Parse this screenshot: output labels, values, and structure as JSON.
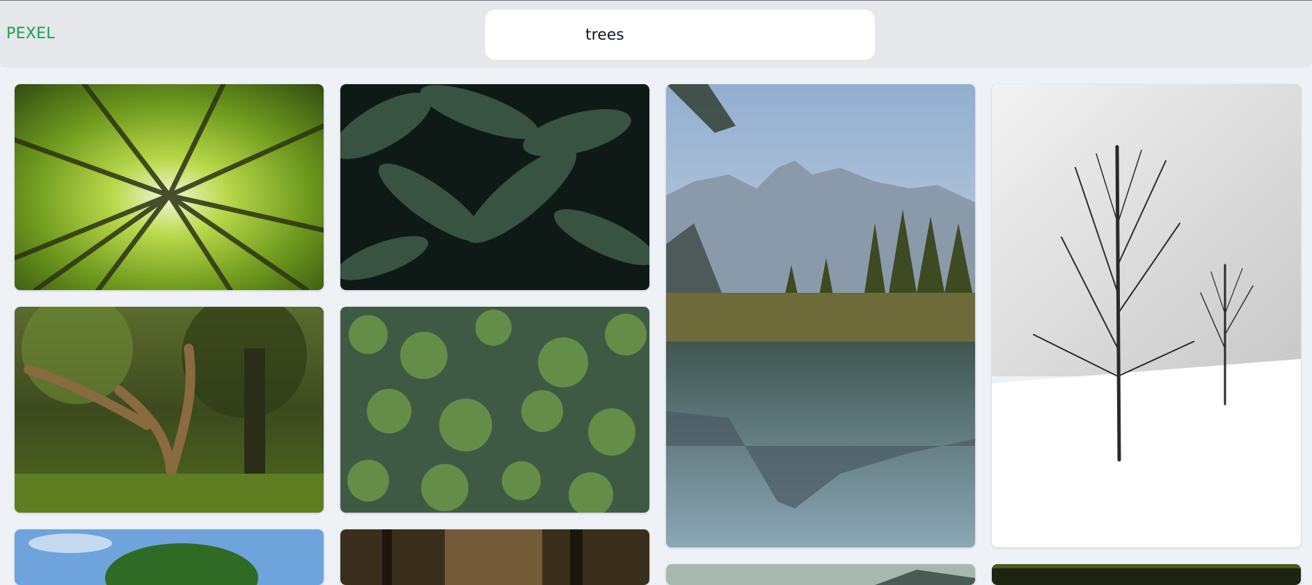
{
  "header": {
    "logo": "PEXEL",
    "search": {
      "value": "trees"
    }
  },
  "gallery": {
    "photos": [
      {
        "subject": "green-canopy-from-below"
      },
      {
        "subject": "dark-palm-fronds"
      },
      {
        "subject": "mountain-lake-reflection"
      },
      {
        "subject": "bare-trees-in-snow"
      },
      {
        "subject": "large-old-tree-in-forest"
      },
      {
        "subject": "aerial-forest-canopy"
      },
      {
        "subject": "tree-under-blue-sky"
      },
      {
        "subject": "forest-with-sunlight"
      },
      {
        "subject": "misty-mountain-landscape"
      },
      {
        "subject": "dark-forest-scene"
      }
    ]
  },
  "colors": {
    "brand": "#16a34a",
    "topbar": "#e5e7eb",
    "page_background": "#eef2f7"
  }
}
